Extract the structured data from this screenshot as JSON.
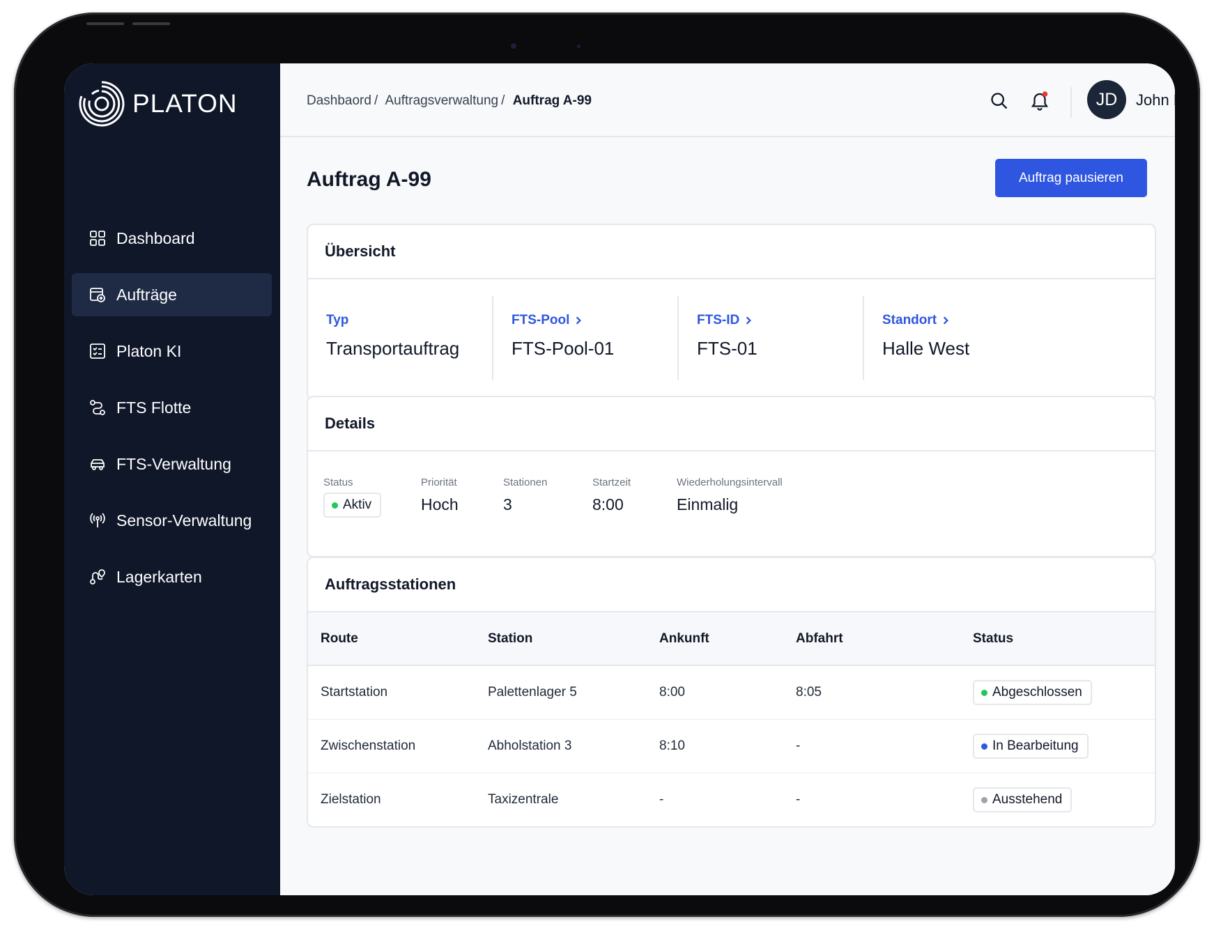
{
  "app": {
    "logo_text": "PLATON"
  },
  "sidebar": {
    "items": [
      {
        "label": "Dashboard",
        "icon": "grid-icon"
      },
      {
        "label": "Aufträge",
        "icon": "orders-icon"
      },
      {
        "label": "Platon KI",
        "icon": "checklist-icon"
      },
      {
        "label": "FTS Flotte",
        "icon": "route-icon"
      },
      {
        "label": "FTS-Verwaltung",
        "icon": "vehicle-icon"
      },
      {
        "label": "Sensor-Verwaltung",
        "icon": "sensor-icon"
      },
      {
        "label": "Lagerkarten",
        "icon": "map-pin-icon"
      }
    ],
    "active_item": "Aufträge"
  },
  "header": {
    "breadcrumb": [
      "Dashbaord",
      "Auftragsverwaltung",
      "Auftrag A-99"
    ],
    "breadcrumb_separator": "/",
    "user": {
      "initials": "JD",
      "name": "John Doe"
    },
    "notification_dot_color": "#e53935"
  },
  "page": {
    "title": "Auftrag A-99",
    "primary_action": "Auftrag pausieren",
    "accent_color": "#2f56e0"
  },
  "overview": {
    "title": "Übersicht",
    "fields": [
      {
        "label": "Typ",
        "value": "Transportauftrag",
        "link": false
      },
      {
        "label": "FTS-Pool",
        "value": "FTS-Pool-01",
        "link": true
      },
      {
        "label": "FTS-ID",
        "value": "FTS-01",
        "link": true
      },
      {
        "label": "Standort",
        "value": "Halle West",
        "link": true
      }
    ]
  },
  "details": {
    "title": "Details",
    "status_label": "Status",
    "status_value": "Aktiv",
    "status_color": "#22c55e",
    "fields": [
      {
        "label": "Priorität",
        "value": "Hoch"
      },
      {
        "label": "Stationen",
        "value": "3"
      },
      {
        "label": "Startzeit",
        "value": "8:00"
      },
      {
        "label": "Wiederholungsintervall",
        "value": "Einmalig"
      }
    ]
  },
  "stations": {
    "title": "Auftragsstationen",
    "columns": [
      "Route",
      "Station",
      "Ankunft",
      "Abfahrt",
      "Status"
    ],
    "rows": [
      {
        "route": "Startstation",
        "station": "Palettenlager 5",
        "arrival": "8:00",
        "departure": "8:05",
        "status": "Abgeschlossen",
        "status_color": "#22c55e"
      },
      {
        "route": "Zwischenstation",
        "station": "Abholstation 3",
        "arrival": "8:10",
        "departure": "-",
        "status": "In Bearbeitung",
        "status_color": "#2f56e0"
      },
      {
        "route": "Zielstation",
        "station": "Taxizentrale",
        "arrival": "-",
        "departure": "-",
        "status": "Ausstehend",
        "status_color": "#9ca3af"
      }
    ]
  }
}
